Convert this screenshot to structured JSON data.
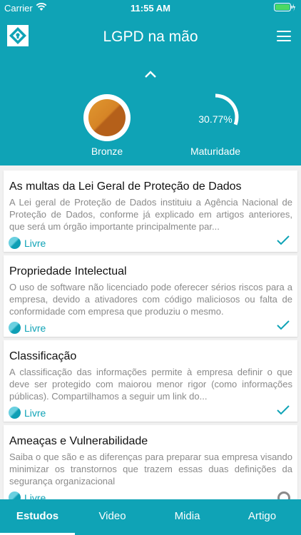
{
  "status_bar": {
    "carrier": "Carrier",
    "time": "11:55 AM"
  },
  "header": {
    "title": "LGPD na mão"
  },
  "stats": {
    "medal": {
      "label": "Bronze"
    },
    "maturity": {
      "value_text": "30.77%",
      "fraction": 0.3077,
      "label": "Maturidade"
    }
  },
  "articles": [
    {
      "title": "As multas da Lei Geral de Proteção de Dados",
      "description": "A Lei geral de Proteção de Dados instituiu a Agência Nacional de Proteção de Dados, conforme já explicado em artigos anteriores, que será um órgão importante principalmente par...",
      "badge": "Livre",
      "status": "completed"
    },
    {
      "title": "Propriedade Intelectual",
      "description": "O uso de software não licenciado pode oferecer sérios riscos para a empresa, devido a ativadores com código maliciosos ou falta de conformidade com empresa que produziu o mesmo.",
      "badge": "Livre",
      "status": "completed"
    },
    {
      "title": "Classificação",
      "description": "A classificação das informações permite à empresa definir o que deve ser protegido com maiorou menor rigor (como informações públicas). Compartilhamos a seguir um link do...",
      "badge": "Livre",
      "status": "completed"
    },
    {
      "title": "Ameaças e Vulnerabilidade",
      "description": "Saiba o que são e as diferenças para preparar sua empresa visando minimizar os transtornos que trazem essas duas definições da segurança organizacional",
      "badge": "Livre",
      "status": "pending"
    }
  ],
  "tabs": [
    {
      "label": "Estudos",
      "active": true
    },
    {
      "label": "Video",
      "active": false
    },
    {
      "label": "Midia",
      "active": false
    },
    {
      "label": "Artigo",
      "active": false
    }
  ],
  "colors": {
    "primary": "#0fa3b6",
    "bronze": "#d68426",
    "muted": "#8a8a8a"
  }
}
